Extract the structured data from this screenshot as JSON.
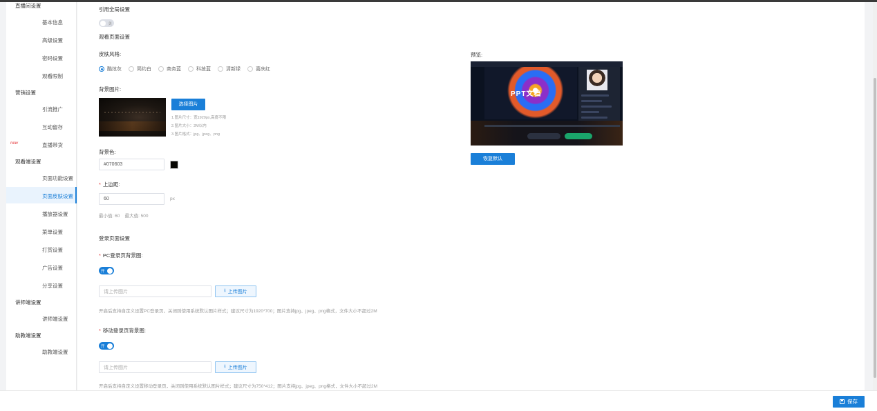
{
  "sidebar": {
    "groups": [
      {
        "label": "直播间设置",
        "items": [
          "基本信息",
          "高级设置",
          "密码设置",
          "观看限制"
        ]
      },
      {
        "label": "营销设置",
        "items": [
          "引流推广",
          "互动留存",
          "直播带货"
        ]
      },
      {
        "label": "观看端设置",
        "items": [
          "页面功能设置",
          "页面皮肤设置",
          "播放器设置",
          "菜单设置",
          "打赏设置",
          "广告设置",
          "分享设置"
        ]
      },
      {
        "label": "讲师端设置",
        "items": [
          "讲师端设置"
        ]
      },
      {
        "label": "助教端设置",
        "items": [
          "助教端设置"
        ]
      }
    ],
    "new_tag": "new",
    "active_item": "页面皮肤设置"
  },
  "global": {
    "label": "引用全局设置",
    "toggle_text": "关",
    "toggle_on": false
  },
  "watch_page": {
    "section_title": "观看页面设置",
    "skin_label": "皮肤风格:",
    "skins": [
      "酷炫灰",
      "简约白",
      "商务蓝",
      "科技蓝",
      "清新绿",
      "喜庆红"
    ],
    "selected_skin": "酷炫灰",
    "bg_image_label": "背景图片:",
    "choose_image_button": "选择图片",
    "image_notes": [
      "1.图片尺寸：宽1920px,高度不限",
      "2.图片大小：2M以内",
      "3.图片格式：jpg、jpeg、png"
    ],
    "bg_color_label": "背景色:",
    "bg_color_value": "#070603",
    "bg_color_swatch": "#070603",
    "top_margin_label": "上边距:",
    "top_margin_value": "60",
    "top_margin_unit": "px",
    "top_margin_hint": "最小值: 60    最大值: 500"
  },
  "preview": {
    "label": "预览:",
    "slide_title": "PPT文档",
    "restore_button": "恢复默认"
  },
  "login_page": {
    "section_title": "登录页面设置",
    "pc_label": "PC登录页背景图:",
    "pc_toggle_text": "开",
    "pc_upload_placeholder": "请上传图片",
    "pc_upload_button": "上传图片",
    "pc_hint": "开启后支持自定义设置PC登录页，关闭则使用系统默认图片样式；建议尺寸为1920*700；图片支持jpg、jpeg、png格式，文件大小不超过2M",
    "mobile_label": "移动登录页背景图:",
    "mobile_toggle_text": "开",
    "mobile_upload_placeholder": "请上传图片",
    "mobile_upload_button": "上传图片",
    "mobile_hint": "开启后支持自定义设置移动登录页，关闭则使用系统默认图片样式；建议尺寸为750*412；图片支持jpg、jpeg、png格式，文件大小不超过2M"
  },
  "footer": {
    "save_button": "保存"
  },
  "colors": {
    "accent": "#1a7fd8",
    "required": "#e4393c"
  }
}
